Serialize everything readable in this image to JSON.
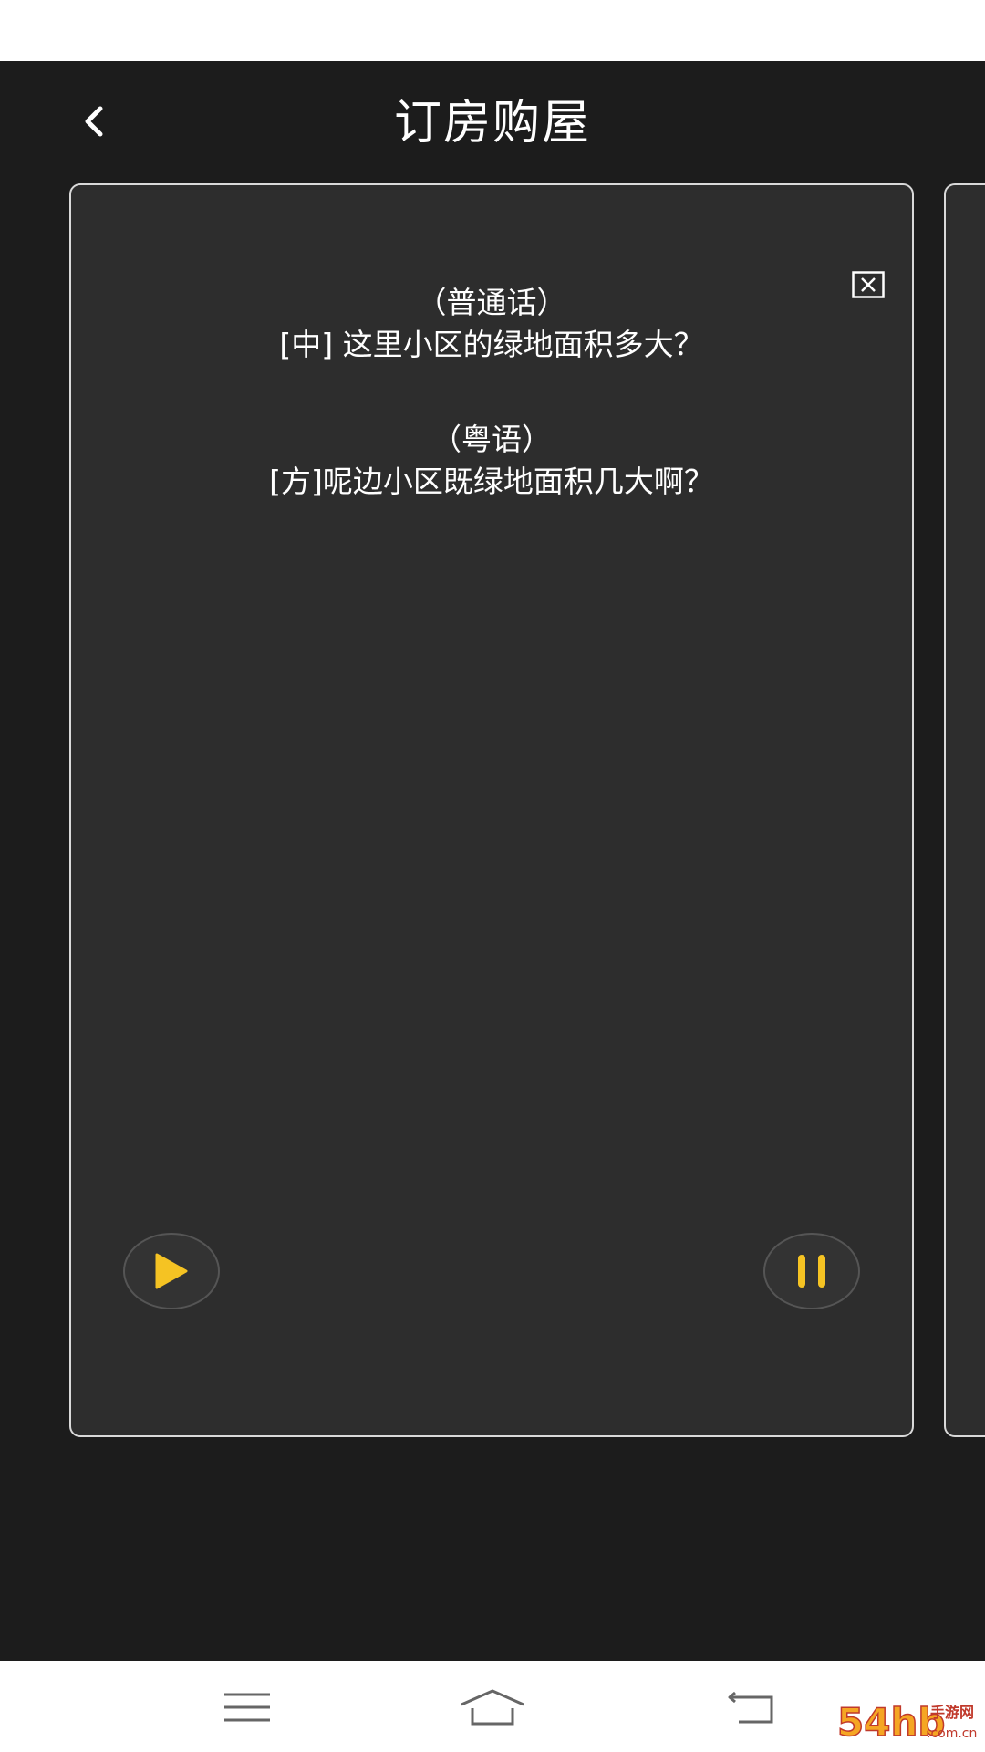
{
  "header": {
    "title": "订房购屋",
    "back_icon": "chevron-left-icon"
  },
  "card": {
    "close_icon": "close-box-icon",
    "phrases": [
      {
        "label": "（普通话）",
        "text": "[中] 这里小区的绿地面积多大？"
      },
      {
        "label": "（粤语）",
        "text": "[方]呢边小区既绿地面积几大啊？"
      }
    ],
    "play_icon": "play-icon",
    "pause_icon": "pause-icon"
  },
  "nav": {
    "menu_icon": "menu-icon",
    "home_icon": "home-icon",
    "back_icon": "back-icon"
  },
  "watermark": {
    "brand": "54hb",
    "line1": "手游网",
    "line2": ".com.cn"
  },
  "colors": {
    "background": "#1c1c1c",
    "card": "#2d2d2d",
    "accent": "#f5c323",
    "border": "#d9d9d9"
  }
}
